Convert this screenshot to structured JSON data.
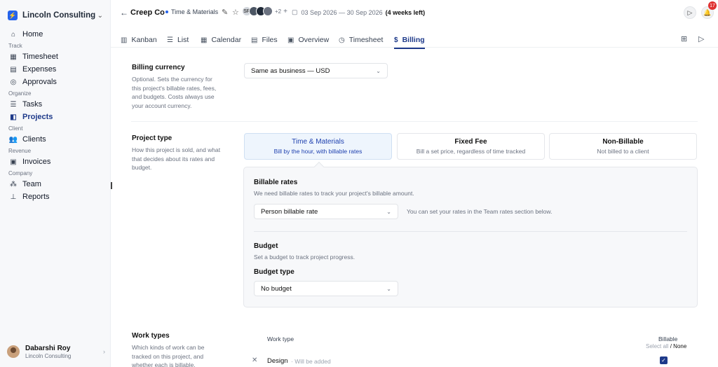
{
  "sidebar": {
    "workspace": "Lincoln Consulting",
    "sections": {
      "track": "Track",
      "organize": "Organize",
      "client": "Client",
      "revenue": "Revenue",
      "company": "Company"
    },
    "items": {
      "home": "Home",
      "timesheet": "Timesheet",
      "expenses": "Expenses",
      "approvals": "Approvals",
      "tasks": "Tasks",
      "projects": "Projects",
      "clients": "Clients",
      "invoices": "Invoices",
      "team": "Team",
      "reports": "Reports"
    },
    "user": {
      "name": "Dabarshi Roy",
      "org": "Lincoln Consulting"
    }
  },
  "topbar": {
    "project_name": "Creep Co",
    "billing_tag": "Time & Materials",
    "avatars_more": "+2",
    "avatar_initials": "SR",
    "date_range": "03 Sep 2026 — 30 Sep 2026",
    "time_left": "(4 weeks left)",
    "notification_count": "17"
  },
  "tabs": {
    "kanban": "Kanban",
    "list": "List",
    "calendar": "Calendar",
    "files": "Files",
    "overview": "Overview",
    "timesheet": "Timesheet",
    "billing": "Billing"
  },
  "billing_currency": {
    "title": "Billing currency",
    "desc": "Optional. Sets the currency for this project's billable rates, fees, and budgets. Costs always use your account currency.",
    "value": "Same as business — USD"
  },
  "project_type": {
    "title": "Project type",
    "desc": "How this project is sold, and what that decides about its rates and budget.",
    "options": [
      {
        "title": "Time & Materials",
        "sub": "Bill by the hour, with billable rates"
      },
      {
        "title": "Fixed Fee",
        "sub": "Bill a set price, regardless of time tracked"
      },
      {
        "title": "Non-Billable",
        "sub": "Not billed to a client"
      }
    ]
  },
  "panel": {
    "rates_title": "Billable rates",
    "rates_desc": "We need billable rates to track your project's billable amount.",
    "rate_select": "Person billable rate",
    "rate_hint": "You can set your rates in the Team rates section below.",
    "budget_title": "Budget",
    "budget_desc": "Set a budget to track project progress.",
    "budget_type_label": "Budget type",
    "budget_select": "No budget"
  },
  "work_types": {
    "title": "Work types",
    "desc": "Which kinds of work can be tracked on this project, and whether each is billable.",
    "col_work_type": "Work type",
    "col_billable": "Billable",
    "select_all": "Select all",
    "slash": "/",
    "none": "None",
    "rows": [
      {
        "name": "Design",
        "note": "· Will be added"
      }
    ]
  }
}
